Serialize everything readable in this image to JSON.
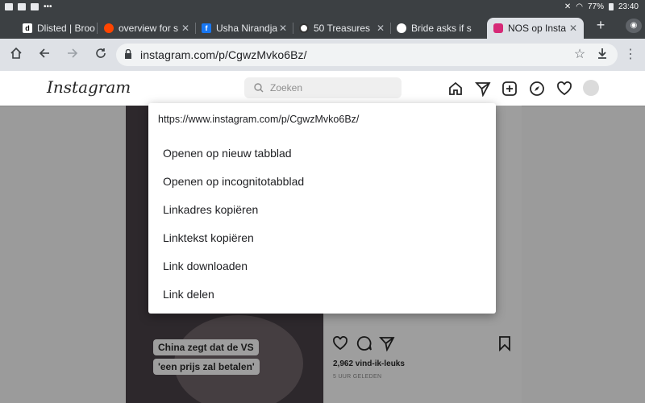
{
  "status_bar": {
    "battery": "77%",
    "time": "23:40"
  },
  "tabs": [
    {
      "title": "Dlisted | Broo",
      "favicon": "d",
      "fav_bg": "#ffffff",
      "fav_color": "#000000"
    },
    {
      "title": "overview for s",
      "favicon": "reddit-icon",
      "fav_bg": "#ff4500",
      "fav_color": "#ffffff"
    },
    {
      "title": "Usha Nirandja",
      "favicon": "f",
      "fav_bg": "#1877f2",
      "fav_color": "#ffffff"
    },
    {
      "title": "50 Treasures",
      "favicon": "ring-icon",
      "fav_bg": "#ffffff",
      "fav_color": "#333333"
    },
    {
      "title": "Bride asks if s",
      "favicon": "dot-icon",
      "fav_bg": "#ffffff",
      "fav_color": "#000000"
    },
    {
      "title": "NOS op Insta",
      "favicon": "instagram-icon",
      "fav_bg": "#d62976",
      "fav_color": "#ffffff",
      "active": true
    }
  ],
  "toolbar": {
    "url": "instagram.com/p/CgwzMvko6Bz/"
  },
  "instagram": {
    "logo": "Instagram",
    "search_placeholder": "Zoeken"
  },
  "post": {
    "caption_line1": "China zegt dat de VS",
    "caption_line2": "'een prijs zal betalen'",
    "likes": "2,962 vind-ik-leuks",
    "posted": "5 UUR GELEDEN"
  },
  "context_menu": {
    "url": "https://www.instagram.com/p/CgwzMvko6Bz/",
    "items": [
      "Openen op nieuw tabblad",
      "Openen op incognitotabblad",
      "Linkadres kopiëren",
      "Linktekst kopiëren",
      "Link downloaden",
      "Link delen"
    ]
  },
  "colors": {
    "chrome_dark": "#3c4043",
    "chrome_light": "#dee1e6",
    "overlay": "rgba(0,0,0,0.38)"
  }
}
